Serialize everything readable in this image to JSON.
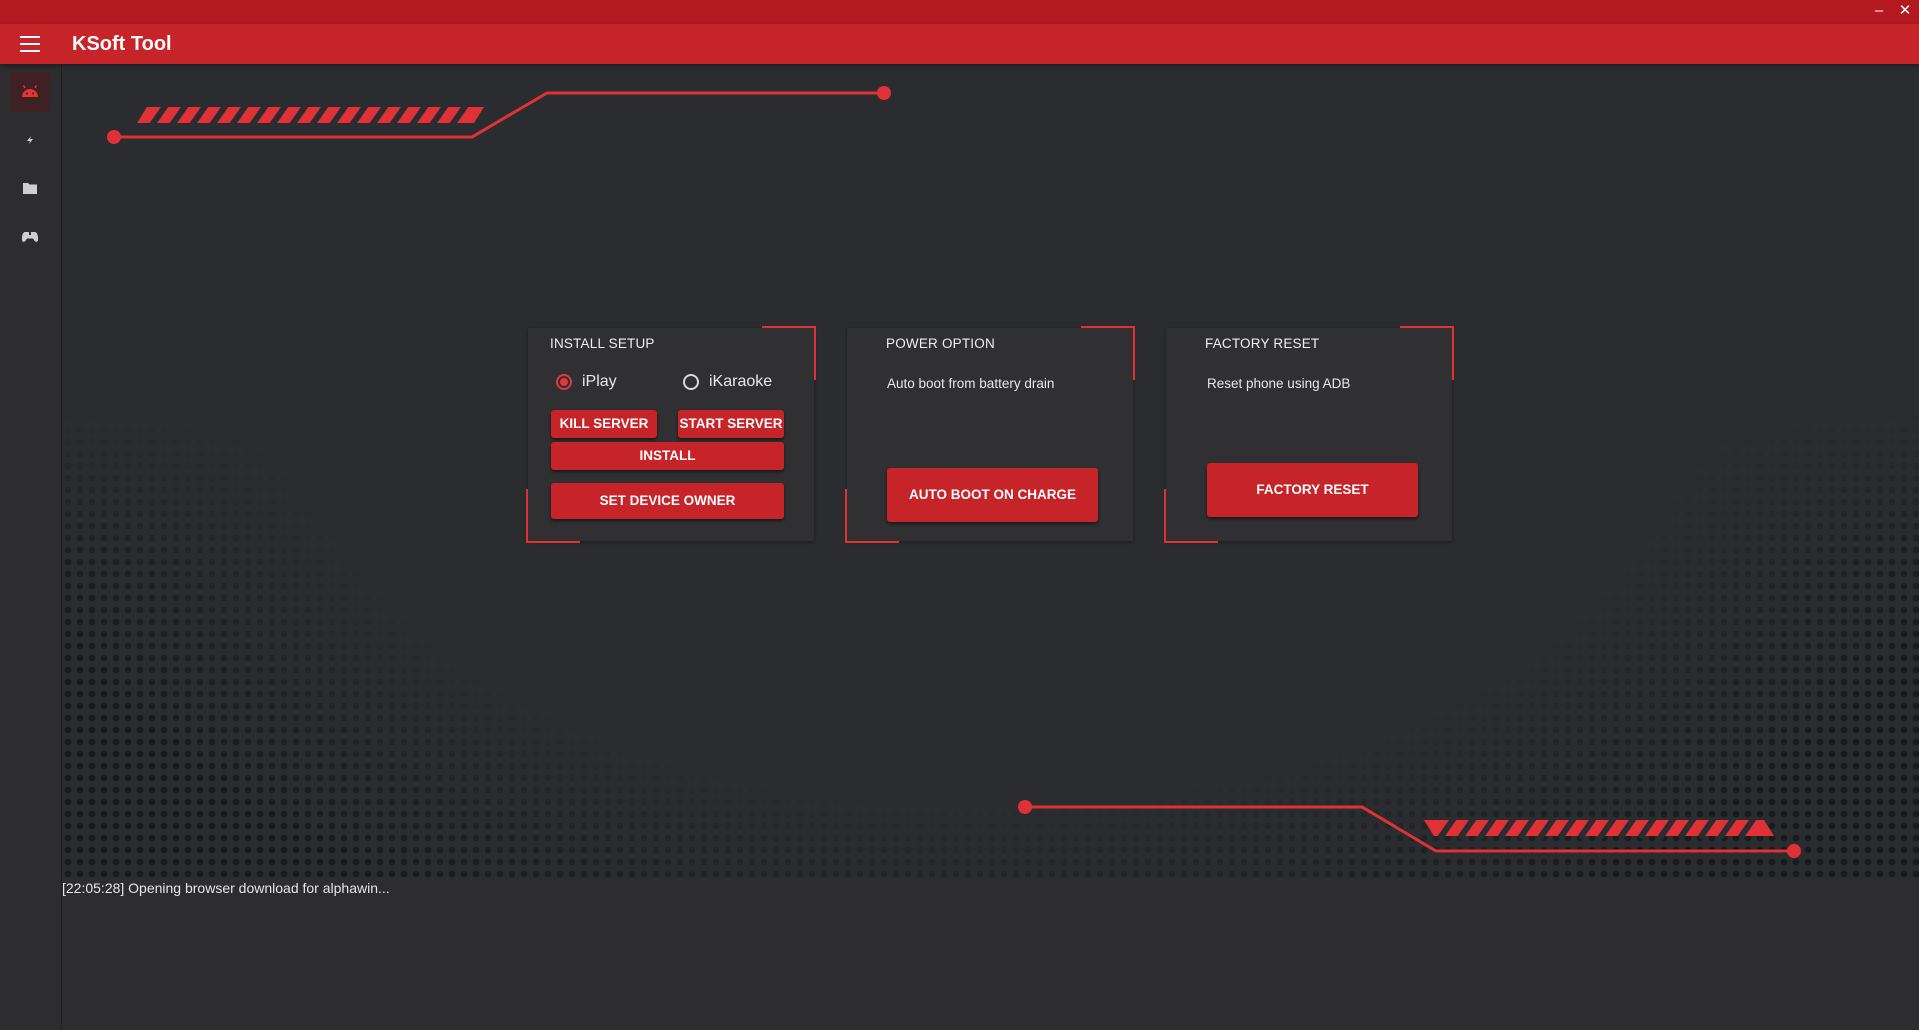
{
  "window": {
    "minimize_glyph": "–",
    "close_glyph": "✕"
  },
  "appbar": {
    "title": "KSoft Tool",
    "menu_icon": "hamburger-menu-icon"
  },
  "sidebar": {
    "items": [
      {
        "icon": "android-icon",
        "active": true
      },
      {
        "icon": "flash-icon",
        "active": false
      },
      {
        "icon": "folder-icon",
        "active": false
      },
      {
        "icon": "gamepad-icon",
        "active": false
      }
    ]
  },
  "install_card": {
    "title": "INSTALL SETUP",
    "radios": [
      {
        "label": "iPlay",
        "checked": true
      },
      {
        "label": "iKaraoke",
        "checked": false
      }
    ],
    "kill_server": "KILL SERVER",
    "start_server": "START SERVER",
    "install": "INSTALL",
    "set_device_owner": "SET DEVICE OWNER"
  },
  "power_card": {
    "title": "POWER OPTION",
    "description": "Auto boot from battery drain",
    "button": "AUTO BOOT ON CHARGE"
  },
  "factory_card": {
    "title": "FACTORY RESET",
    "description": "Reset phone using ADB",
    "button": "FACTORY RESET"
  },
  "log": {
    "line": "[22:05:28] Opening browser download for alphawin..."
  },
  "colors": {
    "accent": "#c62428",
    "titlebar": "#b3191e",
    "background": "#2b2c2f",
    "card": "#303033",
    "highlight": "#e03236"
  }
}
